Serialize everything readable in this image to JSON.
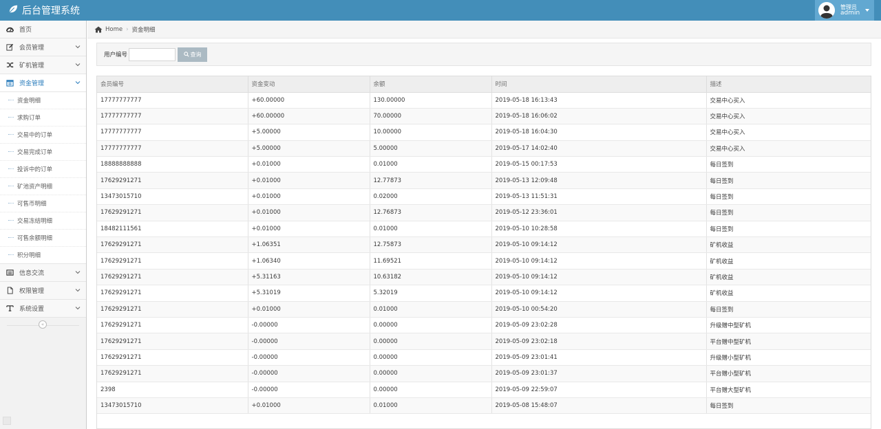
{
  "app": {
    "title": "后台管理系统"
  },
  "user": {
    "role": "管理员",
    "name": "admin"
  },
  "sidebar": {
    "items": [
      {
        "label": "首页",
        "icon": "dashboard-icon"
      },
      {
        "label": "会员管理",
        "icon": "edit-icon"
      },
      {
        "label": "矿机管理",
        "icon": "random-icon"
      },
      {
        "label": "资金管理",
        "icon": "calendar-icon"
      },
      {
        "label": "信息交流",
        "icon": "list-icon"
      },
      {
        "label": "权限管理",
        "icon": "file-icon"
      },
      {
        "label": "系统设置",
        "icon": "text-icon"
      }
    ],
    "submenu": [
      "资金明细",
      "求购订单",
      "交易中的订单",
      "交易完成订单",
      "投诉中的订单",
      "矿池资产明细",
      "可售币明细",
      "交易冻结明细",
      "可售余额明细",
      "积分明细"
    ],
    "collapse_glyph": "«"
  },
  "breadcrumb": {
    "home": "Home",
    "current": "资金明细"
  },
  "search": {
    "label": "用户编号",
    "value": "",
    "button": "查询"
  },
  "table": {
    "headers": [
      "会员编号",
      "资金变动",
      "余额",
      "时间",
      "描述"
    ],
    "rows": [
      [
        "17777777777",
        "+60.00000",
        "130.00000",
        "2019-05-18 16:13:43",
        "交易中心买入"
      ],
      [
        "17777777777",
        "+60.00000",
        "70.00000",
        "2019-05-18 16:06:02",
        "交易中心买入"
      ],
      [
        "17777777777",
        "+5.00000",
        "10.00000",
        "2019-05-18 16:04:30",
        "交易中心买入"
      ],
      [
        "17777777777",
        "+5.00000",
        "5.00000",
        "2019-05-17 14:02:40",
        "交易中心买入"
      ],
      [
        "18888888888",
        "+0.01000",
        "0.01000",
        "2019-05-15 00:17:53",
        "每日签到"
      ],
      [
        "17629291271",
        "+0.01000",
        "12.77873",
        "2019-05-13 12:09:48",
        "每日签到"
      ],
      [
        "13473015710",
        "+0.01000",
        "0.02000",
        "2019-05-13 11:51:31",
        "每日签到"
      ],
      [
        "17629291271",
        "+0.01000",
        "12.76873",
        "2019-05-12 23:36:01",
        "每日签到"
      ],
      [
        "18482111561",
        "+0.01000",
        "0.01000",
        "2019-05-10 10:28:58",
        "每日签到"
      ],
      [
        "17629291271",
        "+1.06351",
        "12.75873",
        "2019-05-10 09:14:12",
        "矿机收益"
      ],
      [
        "17629291271",
        "+1.06340",
        "11.69521",
        "2019-05-10 09:14:12",
        "矿机收益"
      ],
      [
        "17629291271",
        "+5.31163",
        "10.63182",
        "2019-05-10 09:14:12",
        "矿机收益"
      ],
      [
        "17629291271",
        "+5.31019",
        "5.32019",
        "2019-05-10 09:14:12",
        "矿机收益"
      ],
      [
        "17629291271",
        "+0.01000",
        "0.01000",
        "2019-05-10 00:54:20",
        "每日签到"
      ],
      [
        "17629291271",
        "-0.00000",
        "0.00000",
        "2019-05-09 23:02:28",
        "升级赠中型矿机"
      ],
      [
        "17629291271",
        "-0.00000",
        "0.00000",
        "2019-05-09 23:02:18",
        "平台赠中型矿机"
      ],
      [
        "17629291271",
        "-0.00000",
        "0.00000",
        "2019-05-09 23:01:41",
        "升级赠小型矿机"
      ],
      [
        "17629291271",
        "-0.00000",
        "0.00000",
        "2019-05-09 23:01:37",
        "平台赠小型矿机"
      ],
      [
        "2398",
        "-0.00000",
        "0.00000",
        "2019-05-09 22:59:07",
        "平台赠大型矿机"
      ],
      [
        "13473015710",
        "+0.01000",
        "0.01000",
        "2019-05-08 15:48:07",
        "每日签到"
      ]
    ]
  },
  "colors": {
    "navbar": "#438eb9",
    "accent": "#2b7dbc",
    "userbox": "#62a8d1"
  }
}
